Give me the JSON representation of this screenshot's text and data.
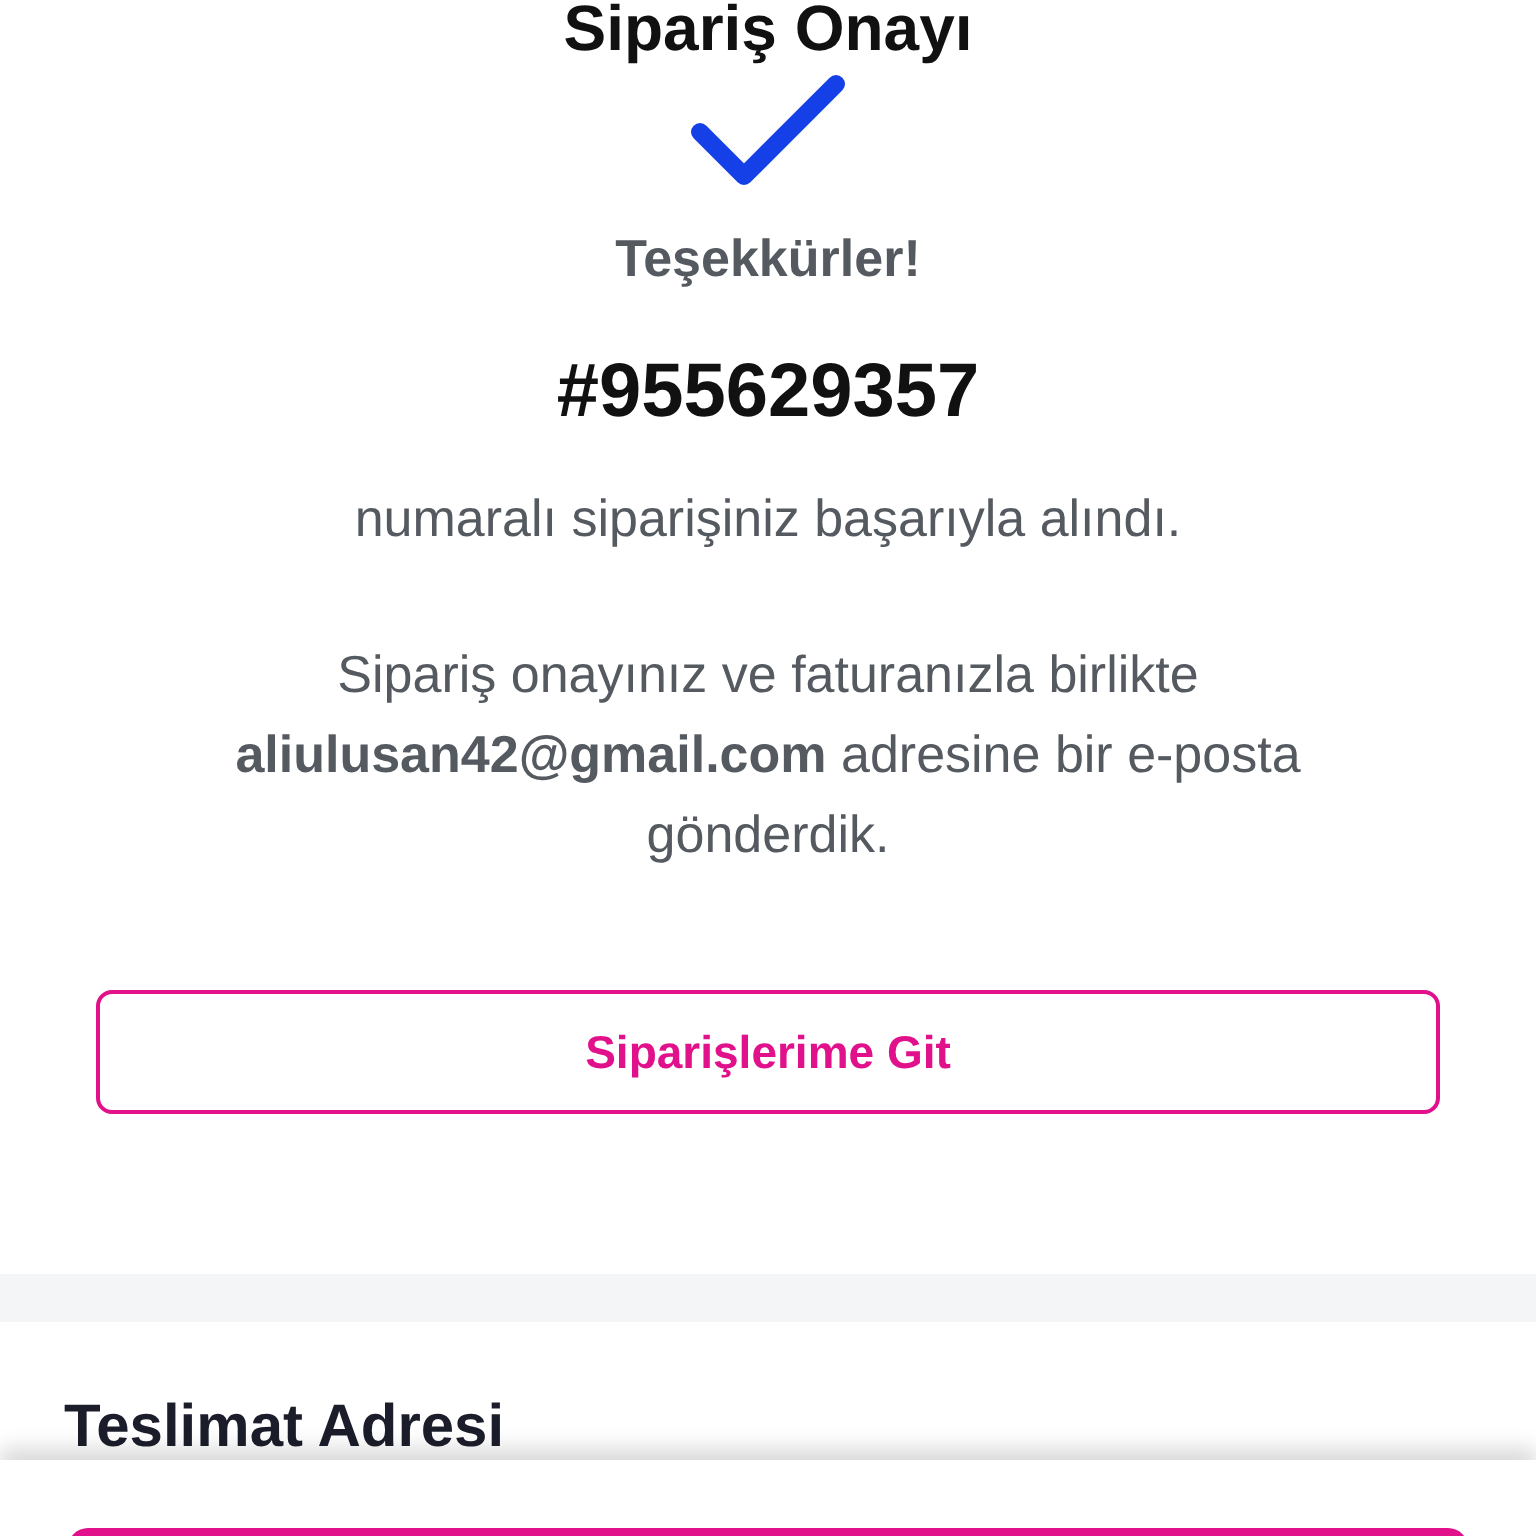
{
  "title": "Sipariş Onayı",
  "thanks": "Teşekkürler!",
  "order_number": "#955629357",
  "received_text": "numaralı siparişiniz başarıyla alındı.",
  "email_text": "Sipariş onayınız ve faturanızla birlikte **aliulusan42@gmail.com** adresine bir e-posta gönderdik.",
  "orders_button": "Siparişlerime Git",
  "delivery_section": {
    "title": "Teslimat Adresi"
  }
}
